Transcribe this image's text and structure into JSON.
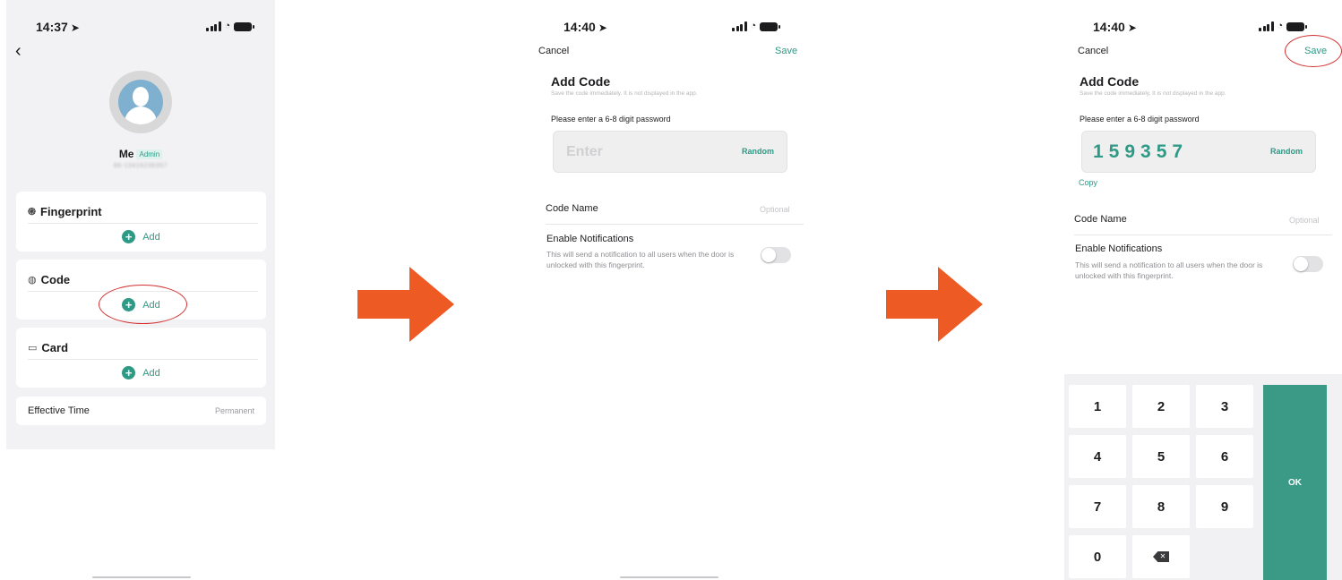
{
  "screen1": {
    "status_time": "14:37",
    "username": "Me",
    "role_badge": "Admin",
    "user_id_masked": "86-13416236357",
    "sections": [
      {
        "title": "Fingerprint",
        "icon": "fingerprint-icon",
        "add_label": "Add"
      },
      {
        "title": "Code",
        "icon": "code-icon",
        "add_label": "Add"
      },
      {
        "title": "Card",
        "icon": "card-icon",
        "add_label": "Add"
      }
    ],
    "effective_time": {
      "label": "Effective Time",
      "value": "Permanent"
    }
  },
  "screen2": {
    "status_time": "14:40",
    "cancel": "Cancel",
    "save": "Save",
    "title": "Add Code",
    "subtitle": "Save the code immediately. It is not displayed in the app.",
    "password_label": "Please enter a 6-8 digit password",
    "password_placeholder": "Enter",
    "random": "Random",
    "code_name_label": "Code Name",
    "code_name_placeholder": "Optional",
    "notif_title": "Enable Notifications",
    "notif_desc": "This will send a notification to all users when the door is unlocked with this fingerprint."
  },
  "screen3": {
    "status_time": "14:40",
    "cancel": "Cancel",
    "save": "Save",
    "title": "Add Code",
    "subtitle": "Save the code immediately. It is not displayed in the app.",
    "password_label": "Please enter a 6-8 digit password",
    "code_value": "159357",
    "random": "Random",
    "copy": "Copy",
    "code_name_label": "Code Name",
    "code_name_placeholder": "Optional",
    "notif_title": "Enable Notifications",
    "notif_desc": "This will send a notification to all users when the door is unlocked with this fingerprint.",
    "keypad": {
      "keys": [
        "1",
        "2",
        "3",
        "4",
        "5",
        "6",
        "7",
        "8",
        "9",
        "0"
      ],
      "ok": "OK"
    }
  },
  "colors": {
    "accent": "#2e9a86",
    "arrow": "#ee5a24",
    "highlight_ring": "#d23030"
  }
}
